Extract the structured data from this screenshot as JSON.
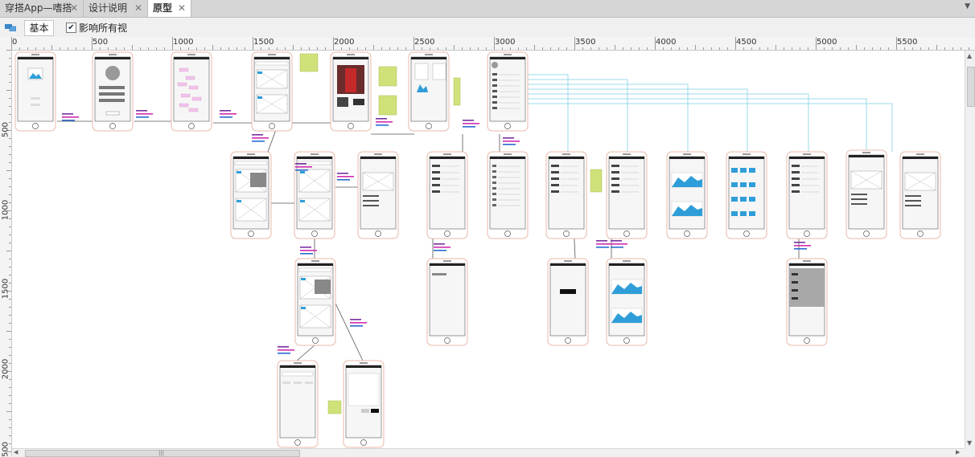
{
  "tabs": [
    {
      "label": "穿搭App—嗜搭",
      "active": false
    },
    {
      "label": "设计说明",
      "active": false
    },
    {
      "label": "原型",
      "active": true
    }
  ],
  "toolbar": {
    "view_button": "基本",
    "affect_all_views_checked": true,
    "affect_all_views_label": "影响所有视"
  },
  "ruler": {
    "horizontal": [
      "0",
      "500",
      "1000",
      "1500",
      "2000",
      "2500",
      "3000",
      "3500",
      "4000",
      "4500",
      "5000",
      "5500"
    ],
    "vertical": [
      "500",
      "1000",
      "1500",
      "2000",
      "500"
    ]
  },
  "icons": {
    "tab_close": "close-icon",
    "tab_overflow": "chevron-down-icon",
    "view_icon": "adaptive-view-icon",
    "checkbox": "checkmark-icon",
    "scroll_up": "arrow-up-icon",
    "scroll_down": "arrow-down-icon",
    "scroll_left": "arrow-left-icon",
    "scroll_right": "arrow-right-icon"
  },
  "colors": {
    "tab_bg": "#d6d6d6",
    "active_tab": "#ffffff",
    "phone_border": "#e8b8a8",
    "sticky_note": "#cfe27a",
    "chart_fill": "#2f9ed8",
    "connector_blue": "#7fd0e6",
    "connector_dark": "#555555",
    "tag_pink": "#f1c4ee"
  }
}
